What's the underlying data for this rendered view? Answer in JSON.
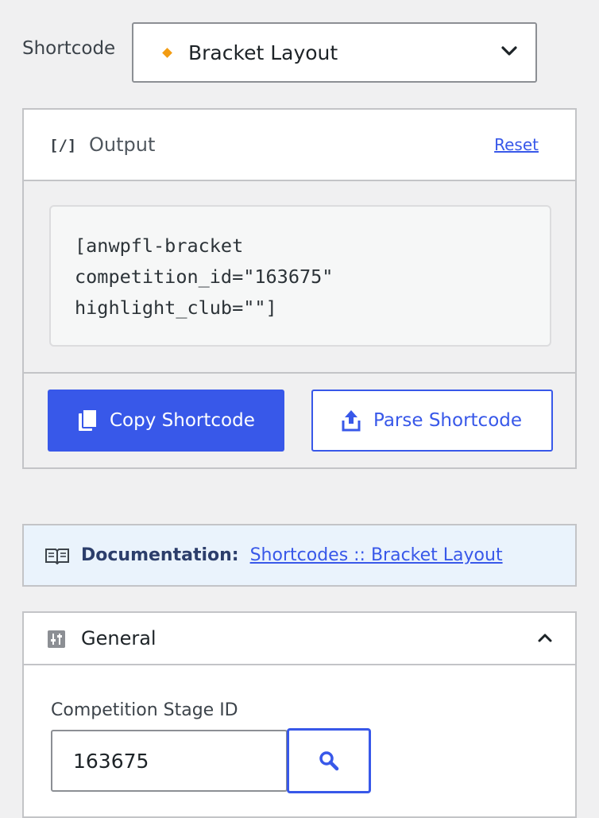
{
  "shortcode": {
    "label": "Shortcode",
    "selected": "Bracket Layout"
  },
  "output": {
    "title": "Output",
    "code_icon": "[/]",
    "reset_label": "Reset",
    "code": "[anwpfl-bracket\ncompetition_id=\"163675\"\nhighlight_club=\"\"]",
    "copy_label": "Copy Shortcode",
    "parse_label": "Parse Shortcode"
  },
  "documentation": {
    "label": "Documentation:",
    "link_text": "Shortcodes :: Bracket Layout"
  },
  "general": {
    "title": "General",
    "stage_label": "Competition Stage ID",
    "stage_value": "163675"
  },
  "icons": {
    "copy": "copy-icon",
    "parse": "upload-icon",
    "book": "book-icon",
    "search": "search-icon",
    "settings": "sliders-icon"
  },
  "colors": {
    "accent": "#3858e9",
    "diamond": "#f39c12",
    "notice_bg": "#eaf3fc"
  }
}
